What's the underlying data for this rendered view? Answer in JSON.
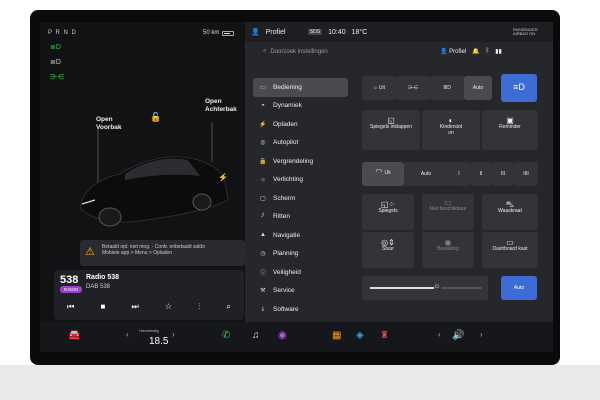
{
  "left": {
    "gear": "P R N D",
    "range": "50 km",
    "labels": {
      "voorbak_a": "Open",
      "voorbak_b": "Voorbak",
      "achterbak_a": "Open",
      "achterbak_b": "Achterbak"
    },
    "warning": {
      "line1": "Betaald opl. niet mog. - Contr. onbetaald saldo",
      "line2": "Mobiele app > Menu > Opladen"
    },
    "media": {
      "logo": "538",
      "badge": "RADIO",
      "title": "Radio 538",
      "subtitle": "DAB 538"
    }
  },
  "topbar": {
    "profile": "Profiel",
    "sos": "SOS",
    "time": "10:40",
    "temp": "18°C",
    "badge": "PASSENGER AIRBAG ON"
  },
  "settings": {
    "search_placeholder": "Doorzoek instellingen",
    "profile_label": "Profiel",
    "menu": [
      {
        "label": "Bediening"
      },
      {
        "label": "Dynamiek"
      },
      {
        "label": "Opladen"
      },
      {
        "label": "Autopilot"
      },
      {
        "label": "Vergrendeling"
      },
      {
        "label": "Verlichting"
      },
      {
        "label": "Scherm"
      },
      {
        "label": "Ritten"
      },
      {
        "label": "Navigatie"
      },
      {
        "label": "Planning"
      },
      {
        "label": "Veiligheid"
      },
      {
        "label": "Service"
      },
      {
        "label": "Software"
      }
    ],
    "lights": {
      "uit": "Uit",
      "auto": "Auto"
    },
    "controls": {
      "spiegels_inklappen": "Spiegels inklappen",
      "kinderslot": "Kinderslot",
      "kinderslot_state": "on",
      "reminder": "Reminder",
      "wipers_uit": "Uit",
      "wipers_auto": "Auto",
      "w1": "I",
      "w2": "II",
      "w3": "III",
      "w4": "IIII",
      "spiegels": "Spiegels",
      "niet_beschikbaar": "Niet beschikbaar",
      "waaskraat": "Waaskraat",
      "stuur": "Stuur",
      "bewaking": "Bewaking",
      "dashboard_kast": "Dashboard kast",
      "brightness_auto": "Auto"
    }
  },
  "dock": {
    "temp_label": "Handmatig",
    "temp": "18.5"
  }
}
